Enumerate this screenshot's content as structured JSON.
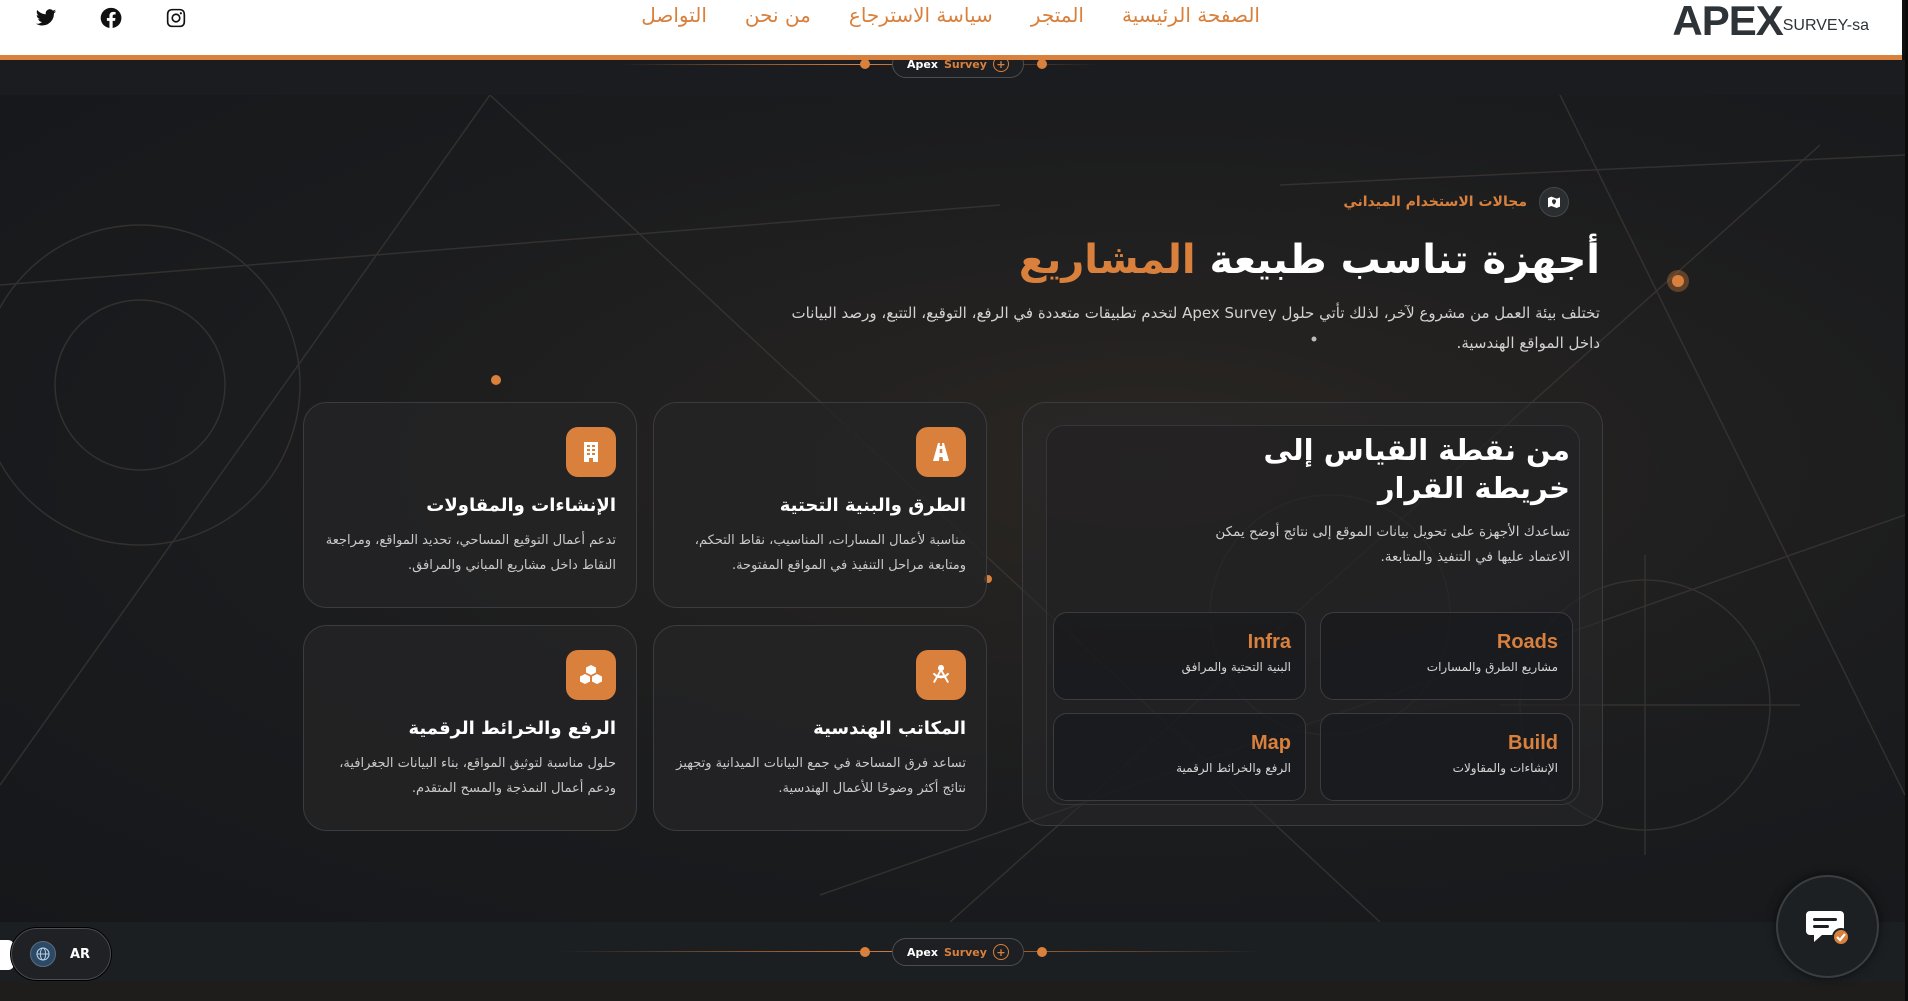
{
  "header": {
    "social": [
      {
        "name": "twitter-icon"
      },
      {
        "name": "facebook-icon"
      },
      {
        "name": "instagram-icon"
      }
    ],
    "nav": [
      "الصفحة الرئيسية",
      "المتجر",
      "سياسة الاسترجاع",
      "من نحن",
      "التواصل"
    ],
    "logo": {
      "mark": "APEX",
      "sub": "SURVEY-sa"
    }
  },
  "slider_pill": {
    "brand_plain": "Apex",
    "brand_accent": "Survey",
    "plus": "+"
  },
  "section": {
    "eyebrow": "مجالات الاستخدام الميداني",
    "title_plain": "أجهزة تناسب طبيعة",
    "title_accent": "المشاريع",
    "description": "تختلف بيئة العمل من مشروع لآخر، لذلك تأتي حلول Apex Survey لتخدم تطبيقات متعددة في الرفع، التوقيع، التتبع، ورصد البيانات داخل المواقع الهندسية."
  },
  "panel": {
    "title": "من نقطة القياس إلى خريطة القرار",
    "text": "تساعدك الأجهزة على تحويل بيانات الموقع إلى نتائج أوضح يمكن الاعتماد عليها في التنفيذ والمتابعة.",
    "tiles": [
      {
        "key": "Roads",
        "label": "مشاريع الطرق والمسارات"
      },
      {
        "key": "Infra",
        "label": "البنية التحتية والمرافق"
      },
      {
        "key": "Build",
        "label": "الإنشاءات والمقاولات"
      },
      {
        "key": "Map",
        "label": "الرفع والخرائط الرقمية"
      }
    ]
  },
  "cards": [
    {
      "icon": "road-icon",
      "title": "الطرق والبنية التحتية",
      "text": "مناسبة لأعمال المسارات، المناسيب، نقاط التحكم، ومتابعة مراحل التنفيذ في المواقع المفتوحة."
    },
    {
      "icon": "building-icon",
      "title": "الإنشاءات والمقاولات",
      "text": "تدعم أعمال التوقيع المساحي، تحديد المواقع، ومراجعة النقاط داخل مشاريع المباني والمرافق."
    },
    {
      "icon": "compass-drafting-icon",
      "title": "المكاتب الهندسية",
      "text": "تساعد فرق المساحة في جمع البيانات الميدانية وتجهيز نتائج أكثر وضوحًا للأعمال الهندسية."
    },
    {
      "icon": "cubes-icon",
      "title": "الرفع والخرائط الرقمية",
      "text": "حلول مناسبة لتوثيق المواقع، بناء البيانات الجغرافية، ودعم أعمال النمذجة والمسح المتقدم."
    }
  ],
  "language": {
    "code": "AR"
  },
  "colors": {
    "accent": "#d9803d",
    "background": "#1a1c1f",
    "header": "#ffffff"
  }
}
